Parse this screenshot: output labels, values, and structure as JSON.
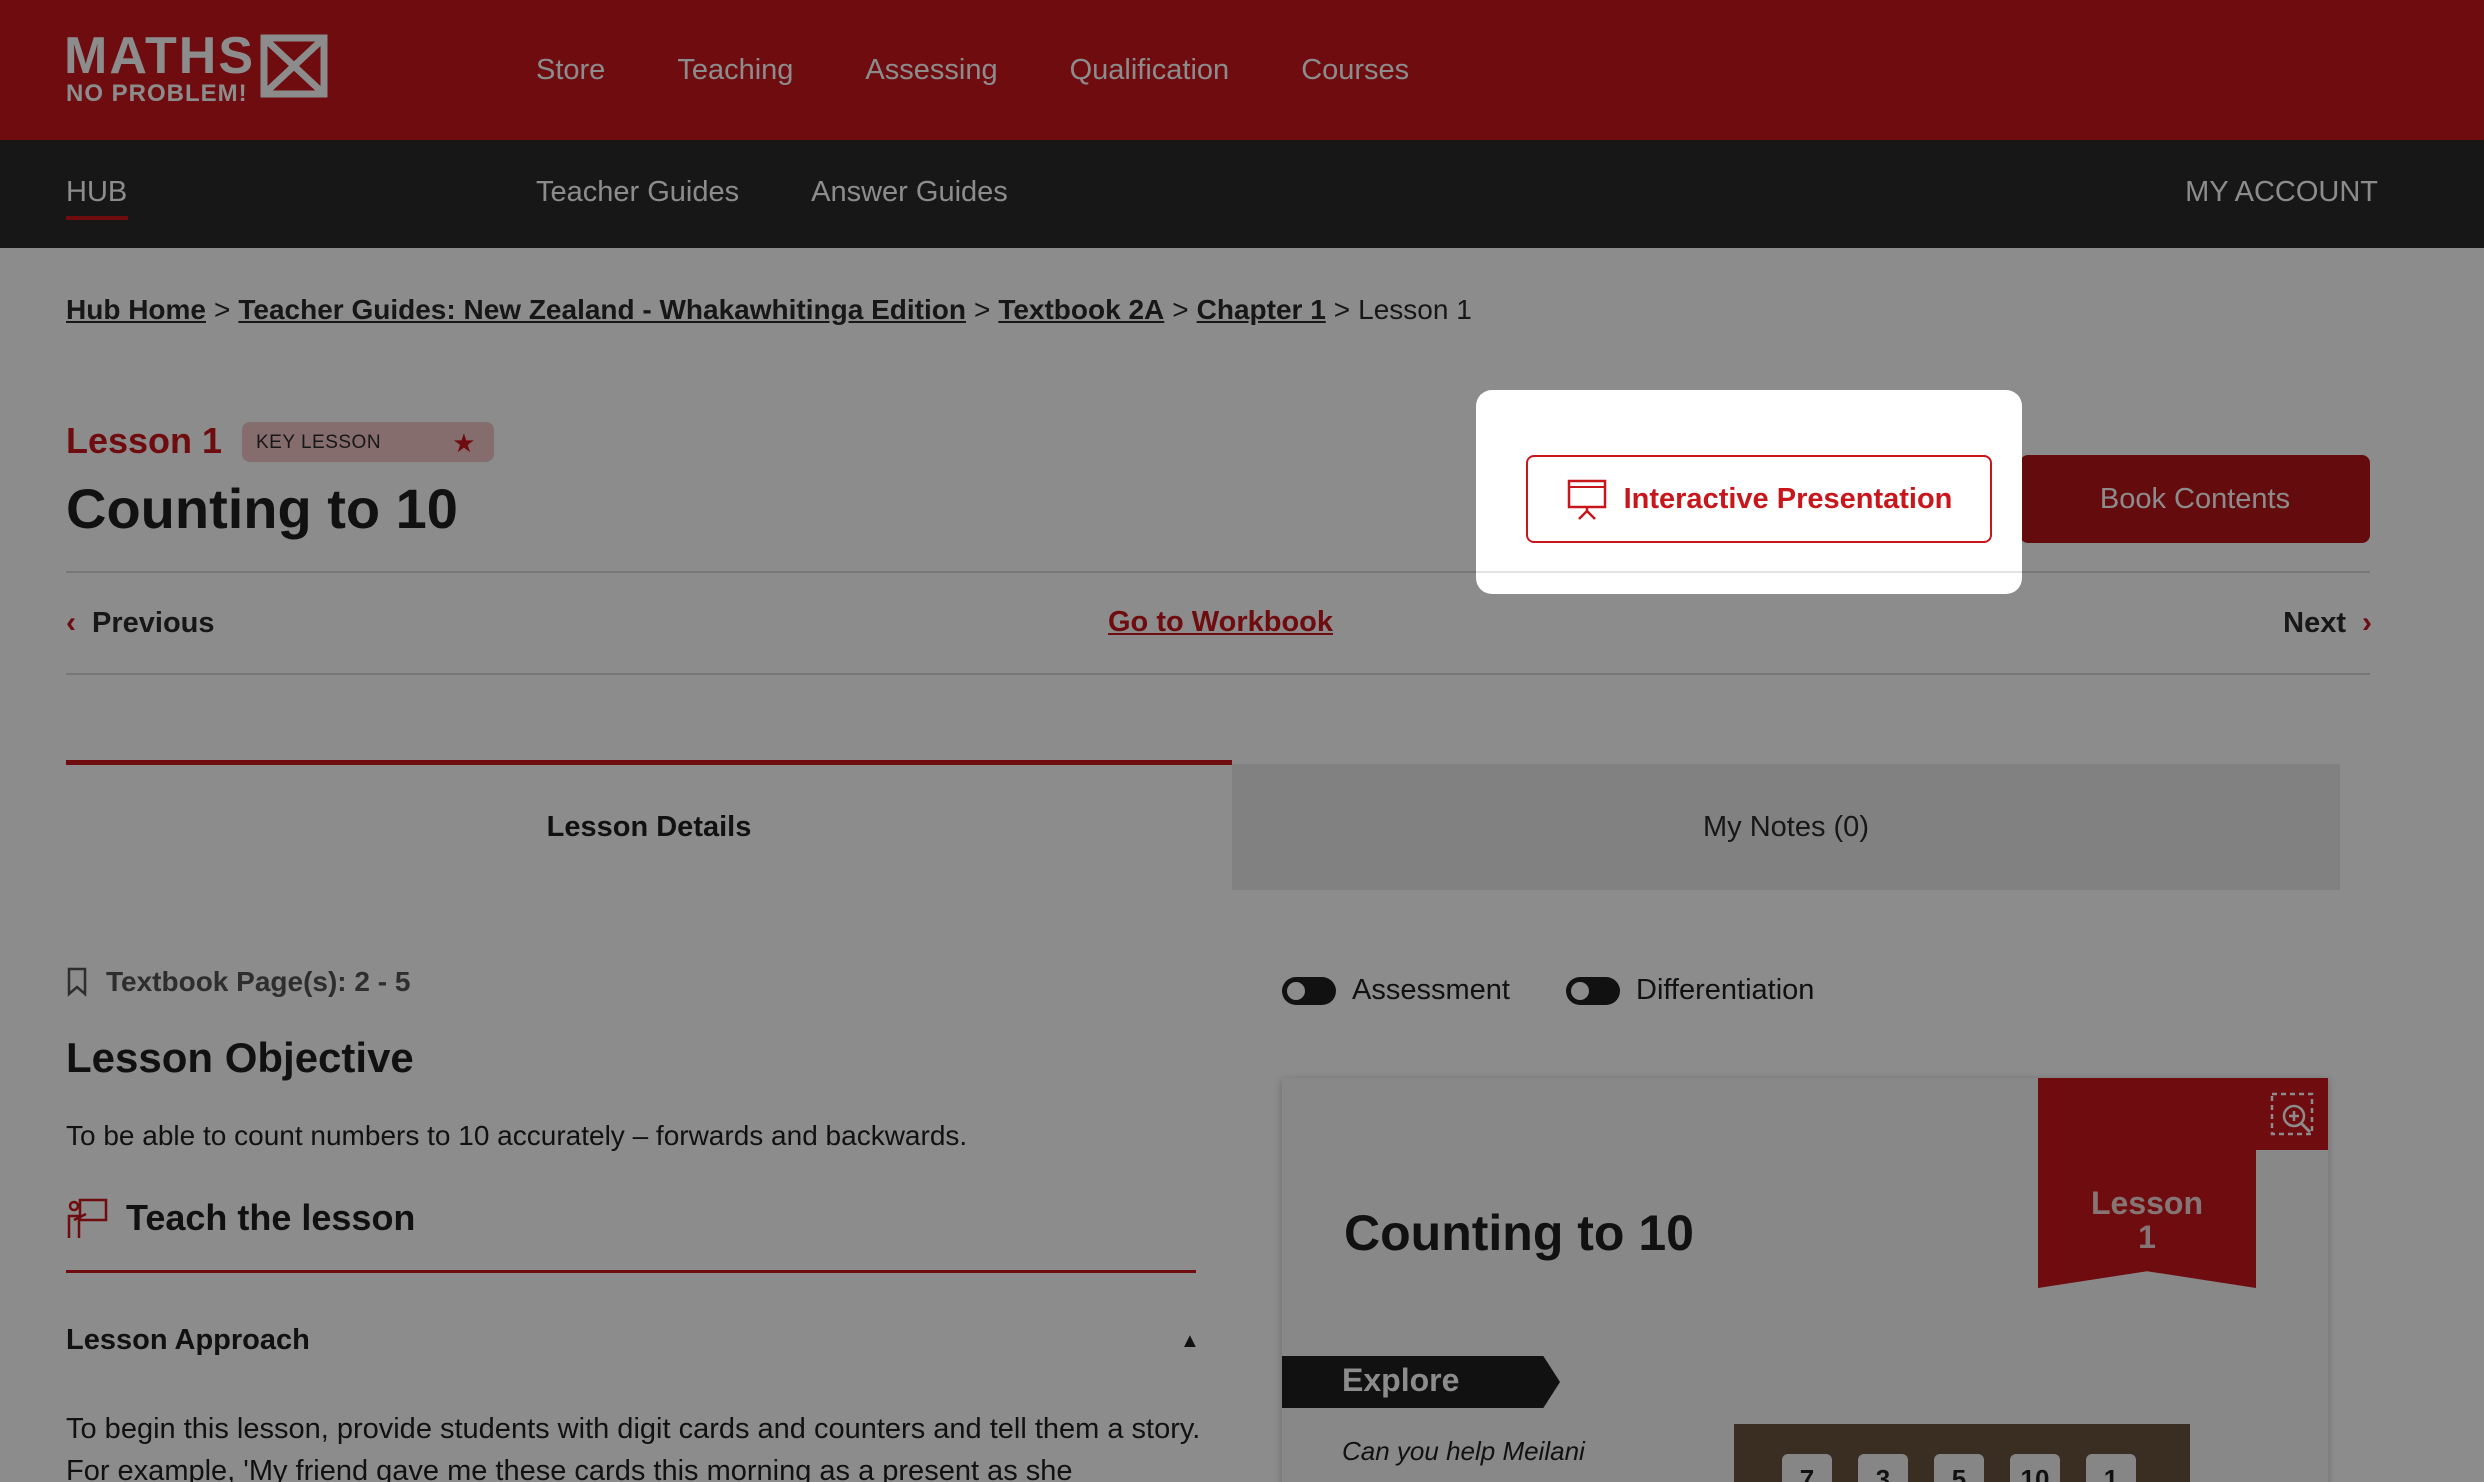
{
  "logo": {
    "line1": "MATHS",
    "line2": "NO PROBLEM!"
  },
  "main_nav": [
    "Store",
    "Teaching",
    "Assessing",
    "Qualification",
    "Courses"
  ],
  "sub_nav": {
    "hub": "HUB",
    "items": [
      "Teacher Guides",
      "Answer Guides"
    ],
    "account": "MY ACCOUNT"
  },
  "breadcrumb": {
    "links": [
      "Hub Home",
      "Teacher Guides: New Zealand - Whakawhitinga Edition",
      "Textbook 2A",
      "Chapter 1"
    ],
    "separator": ">",
    "current": "Lesson 1"
  },
  "lesson": {
    "number_label": "Lesson 1",
    "badge": "KEY LESSON",
    "title": "Counting to 10"
  },
  "actions": {
    "interactive_presentation": "Interactive Presentation",
    "book_contents": "Book Contents"
  },
  "pager": {
    "previous": "Previous",
    "workbook": "Go to Workbook",
    "next": "Next"
  },
  "tabs": [
    "Lesson Details",
    "My Notes (0)"
  ],
  "details": {
    "textbook_pages": "Textbook Page(s): 2 - 5",
    "objective_heading": "Lesson Objective",
    "objective_text": "To be able to count numbers to 10 accurately – forwards and backwards.",
    "teach_heading": "Teach the lesson",
    "approach_heading": "Lesson Approach",
    "approach_text": "To begin this lesson, provide students with digit cards and counters and tell them a story. For example, 'My friend gave me these cards this morning as a present as she"
  },
  "toggles": [
    "Assessment",
    "Differentiation"
  ],
  "preview_card": {
    "title": "Counting to 10",
    "ribbon_line1": "Lesson",
    "ribbon_line2": "1",
    "explore": "Explore",
    "question": "Can you help Meilani",
    "tiles": [
      "7",
      "3",
      "5",
      "10",
      "1"
    ]
  },
  "colors": {
    "brand_red": "#c8161d",
    "dark_bar": "#2b2b2b"
  }
}
